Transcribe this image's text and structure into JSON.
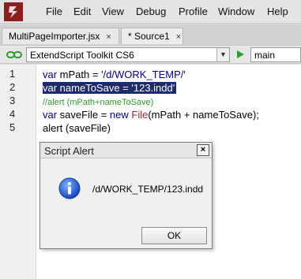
{
  "menubar": {
    "items": [
      "File",
      "Edit",
      "View",
      "Debug",
      "Profile",
      "Window",
      "Help"
    ]
  },
  "tabs": [
    {
      "label": "MultiPageImporter.jsx",
      "close": "×"
    },
    {
      "label": "* Source1",
      "close": "×"
    }
  ],
  "toolbar": {
    "target_app": "ExtendScript Toolkit CS6",
    "engine": "main"
  },
  "editor": {
    "line_numbers": [
      "1",
      "2",
      "3",
      "4",
      "5"
    ],
    "lines": [
      {
        "tokens": [
          [
            "kw",
            "var"
          ],
          [
            "plain",
            " mPath = "
          ],
          [
            "str",
            "'/d/WORK_TEMP/'"
          ]
        ]
      },
      {
        "tokens": [
          [
            "kw",
            "var"
          ],
          [
            "plain",
            " nameToSave = "
          ],
          [
            "str",
            "'123.indd'"
          ]
        ],
        "selected": true
      },
      {
        "tokens": [
          [
            "cmt",
            "//alert (mPath+nameToSave)"
          ]
        ]
      },
      {
        "tokens": [
          [
            "kw",
            "var"
          ],
          [
            "plain",
            " saveFile = "
          ],
          [
            "kw",
            "new"
          ],
          [
            "plain",
            " "
          ],
          [
            "cls",
            "File"
          ],
          [
            "plain",
            "(mPath + nameToSave);"
          ]
        ]
      },
      {
        "tokens": [
          [
            "plain",
            "alert (saveFile)"
          ]
        ]
      }
    ]
  },
  "dialog": {
    "title": "Script Alert",
    "close": "×",
    "message": "/d/WORK_TEMP/123.indd",
    "ok_label": "OK"
  },
  "colors": {
    "keyword": "#00008b",
    "comment": "#2e9a2e",
    "class": "#a0282d",
    "selection": "#1f2a6b"
  },
  "icons": [
    "estk-logo-icon",
    "link-icon",
    "chevron-down-icon",
    "play-icon",
    "info-icon",
    "close-icon"
  ]
}
